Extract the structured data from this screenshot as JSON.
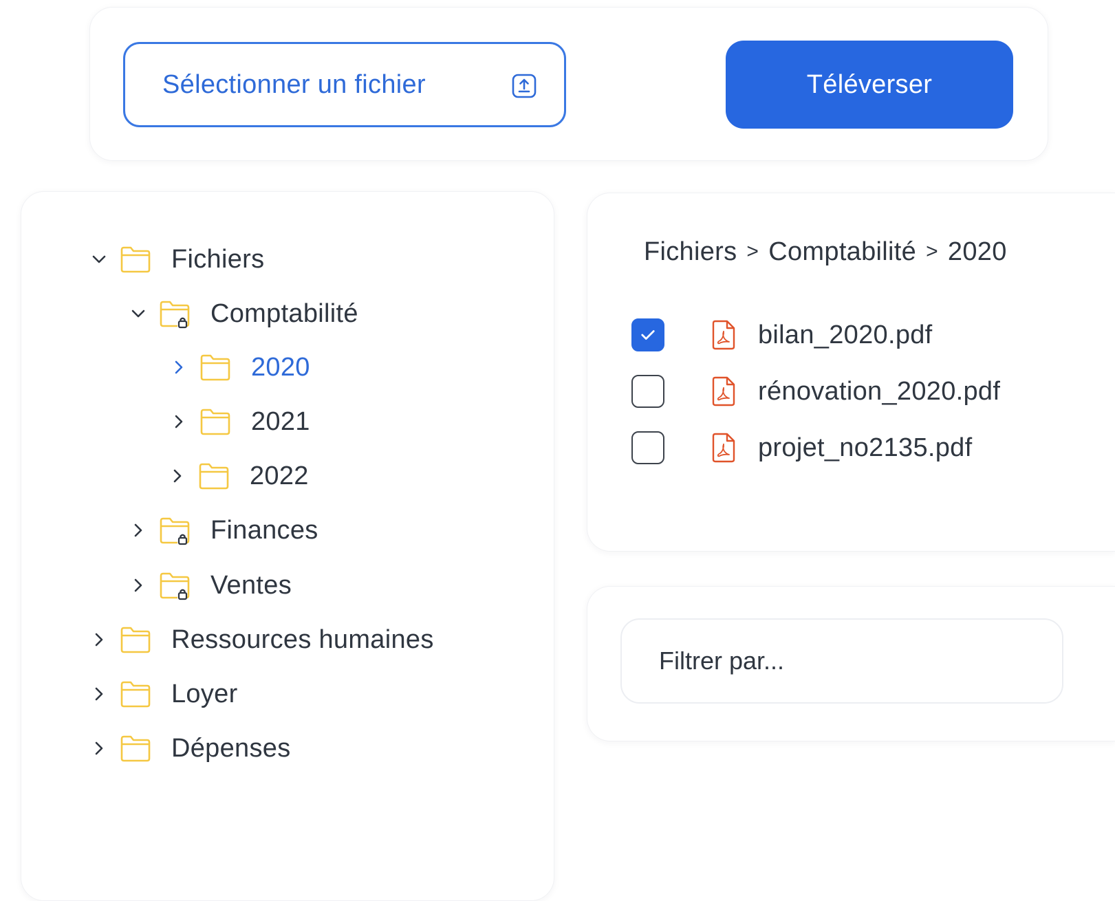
{
  "upload": {
    "select_label": "Sélectionner un fichier",
    "select_icon": "upload-icon",
    "upload_label": "Téléverser",
    "accent": "#2767e0"
  },
  "tree": {
    "items": [
      {
        "label": "Fichiers",
        "expanded": true,
        "locked": false
      },
      {
        "label": "Comptabilité",
        "expanded": true,
        "locked": true
      },
      {
        "label": "2020",
        "expanded": false,
        "locked": false,
        "selected": true
      },
      {
        "label": "2021",
        "expanded": false,
        "locked": false
      },
      {
        "label": "2022",
        "expanded": false,
        "locked": false
      },
      {
        "label": "Finances",
        "expanded": false,
        "locked": true
      },
      {
        "label": "Ventes",
        "expanded": false,
        "locked": true
      },
      {
        "label": "Ressources humaines",
        "expanded": false,
        "locked": false
      },
      {
        "label": "Loyer",
        "expanded": false,
        "locked": false
      },
      {
        "label": "Dépenses",
        "expanded": false,
        "locked": false
      }
    ],
    "folder_color": "#f5c842",
    "selected_color": "#2e6ad8"
  },
  "files": {
    "breadcrumb": [
      "Fichiers",
      "Comptabilité",
      "2020"
    ],
    "breadcrumb_separator": ">",
    "items": [
      {
        "name": "bilan_2020.pdf",
        "checked": true
      },
      {
        "name": "rénovation_2020.pdf",
        "checked": false
      },
      {
        "name": "projet_no2135.pdf",
        "checked": false
      }
    ],
    "pdf_icon_color": "#e0532a"
  },
  "filter": {
    "placeholder": "Filtrer par..."
  }
}
